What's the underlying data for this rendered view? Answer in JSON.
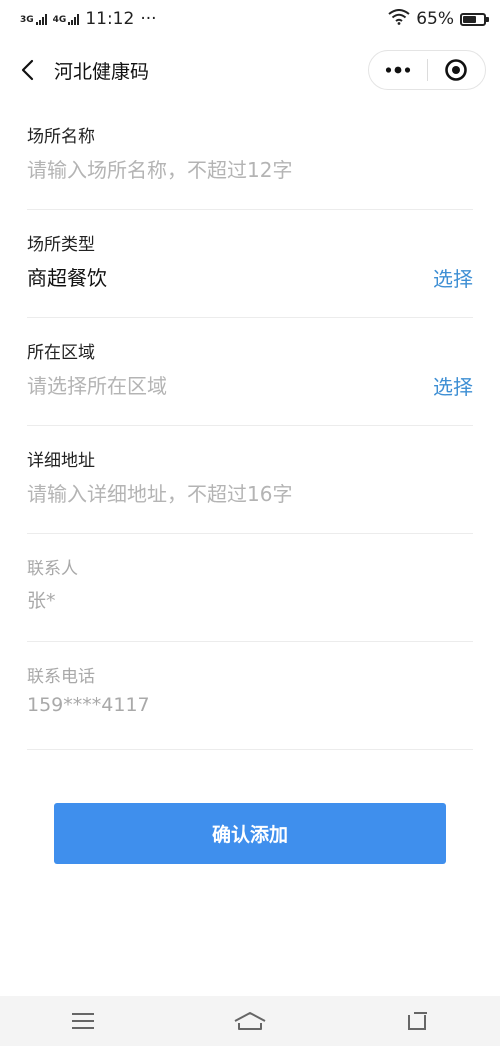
{
  "status_bar": {
    "net1": "3G",
    "net2": "4G",
    "time": "11:12",
    "more": "···",
    "battery_text": "65%",
    "battery_level": 0.65
  },
  "nav": {
    "title": "河北健康码"
  },
  "form": {
    "venue_name": {
      "label": "场所名称",
      "placeholder": "请输入场所名称，不超过12字"
    },
    "venue_type": {
      "label": "场所类型",
      "value": "商超餐饮",
      "action": "选择"
    },
    "region": {
      "label": "所在区域",
      "placeholder": "请选择所在区域",
      "action": "选择"
    },
    "address": {
      "label": "详细地址",
      "placeholder": "请输入详细地址，不超过16字"
    },
    "contact": {
      "label": "联系人",
      "value": "张*"
    },
    "phone": {
      "label": "联系电话",
      "value": "159****4117"
    }
  },
  "confirm_button": "确认添加",
  "colors": {
    "accent": "#3f8fed",
    "link": "#3e8fd4",
    "placeholder": "#b4b4b4"
  },
  "icons": [
    "back-arrow-icon",
    "more-dots-icon",
    "target-icon",
    "menu-icon",
    "home-icon",
    "recent-apps-icon",
    "wifi-icon",
    "battery-icon",
    "signal-icon"
  ]
}
